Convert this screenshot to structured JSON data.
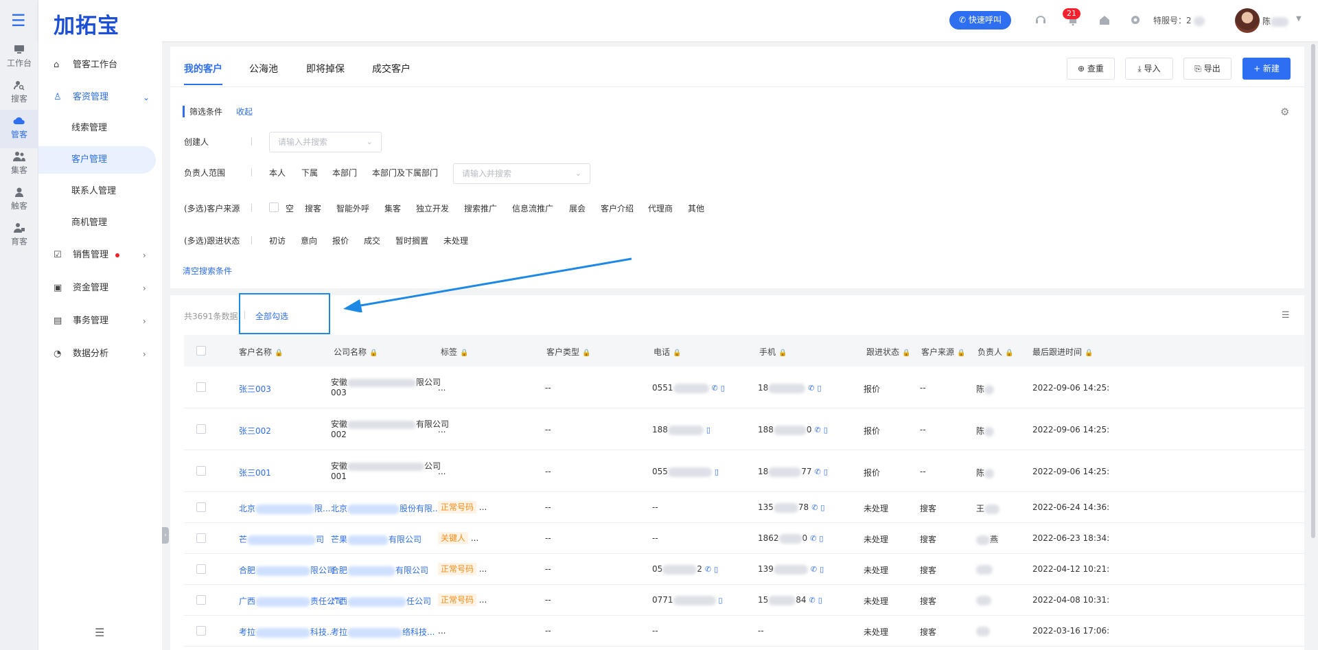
{
  "rail": [
    {
      "label": "工作台",
      "icon": "monitor-icon"
    },
    {
      "label": "搜客",
      "icon": "search-user-icon"
    },
    {
      "label": "管客",
      "icon": "crm-cloud-icon"
    },
    {
      "label": "集客",
      "icon": "group-icon"
    },
    {
      "label": "触客",
      "icon": "headset-user-icon"
    },
    {
      "label": "育客",
      "icon": "users-icon"
    }
  ],
  "topbar": {
    "logo": "加拓宝",
    "quick_call": "快速呼叫",
    "notification_count": "21",
    "account_label": "特服号：2",
    "user_name": "陈"
  },
  "sidenav": {
    "items": [
      {
        "label": "管客工作台"
      },
      {
        "label": "客资管理"
      },
      {
        "label": "线索管理"
      },
      {
        "label": "客户管理"
      },
      {
        "label": "联系人管理"
      },
      {
        "label": "商机管理"
      },
      {
        "label": "销售管理"
      },
      {
        "label": "资金管理"
      },
      {
        "label": "事务管理"
      },
      {
        "label": "数据分析"
      }
    ]
  },
  "tabs": [
    "我的客户",
    "公海池",
    "即将掉保",
    "成交客户"
  ],
  "actions": {
    "dedupe": "查重",
    "import": "导入",
    "export": "导出",
    "create": "+ 新建"
  },
  "filter": {
    "title": "筛选条件",
    "collapse": "收起",
    "creator_label": "创建人",
    "creator_placeholder": "请输入并搜索",
    "owner_label": "负责人范围",
    "owner_options": [
      "本人",
      "下属",
      "本部门",
      "本部门及下属部门"
    ],
    "owner_placeholder": "请输入并搜索",
    "source_label": "(多选)客户来源",
    "source_options": [
      "空",
      "搜客",
      "智能外呼",
      "集客",
      "独立开发",
      "搜索推广",
      "信息流推广",
      "展会",
      "客户介绍",
      "代理商",
      "其他"
    ],
    "status_label": "(多选)跟进状态",
    "status_options": [
      "初访",
      "意向",
      "报价",
      "成交",
      "暂时搁置",
      "未处理"
    ],
    "clear": "清空搜索条件"
  },
  "table": {
    "count_text": "共3691条数据",
    "select_all": "全部勾选",
    "columns": [
      "客户名称",
      "公司名称",
      "标签",
      "客户类型",
      "电话",
      "手机",
      "跟进状态",
      "客户来源",
      "负责人",
      "最后跟进时间"
    ],
    "rows": [
      {
        "name": "张三003",
        "company_a": "安徽",
        "company_b": "限公司",
        "company_line2": "003",
        "tag": "",
        "tag_more": "...",
        "type": "--",
        "phone": "0551",
        "mobile": "18",
        "status": "报价",
        "source": "--",
        "owner": "陈",
        "time": "2022-09-06 14:25:"
      },
      {
        "name": "张三002",
        "company_a": "安徽",
        "company_b": "有限公司",
        "company_line2": "002",
        "tag": "",
        "tag_more": "...",
        "type": "--",
        "phone": "188",
        "mobile": "188",
        "mobile_tail": "0",
        "status": "报价",
        "source": "--",
        "owner": "陈",
        "time": "2022-09-06 14:25:"
      },
      {
        "name": "张三001",
        "company_a": "安徽",
        "company_b": "公司",
        "company_line2": "001",
        "tag": "",
        "tag_more": "...",
        "type": "--",
        "phone": "055",
        "mobile": "18",
        "mobile_tail": "77",
        "status": "报价",
        "source": "--",
        "owner": "陈",
        "time": "2022-09-06 14:25:"
      },
      {
        "name": "北京",
        "name_tail": "限...",
        "company_a": "北京",
        "company_b": "股份有限...",
        "company_line2": "",
        "tag": "正常号码",
        "tag_more": "...",
        "type": "--",
        "phone": "--",
        "mobile": "135",
        "mobile_tail": "78",
        "status": "未处理",
        "source": "搜客",
        "owner": "王",
        "time": "2022-06-24 14:36:"
      },
      {
        "name": "芒",
        "name_tail": "司",
        "company_a": "芒果",
        "company_b": "有限公司",
        "company_line2": "",
        "tag": "关键人",
        "tag_more": "...",
        "type": "--",
        "phone": "--",
        "mobile": "1862",
        "mobile_tail": "0",
        "status": "未处理",
        "source": "搜客",
        "owner": "燕",
        "time": "2022-06-23 18:34:"
      },
      {
        "name": "合肥",
        "name_tail": "限公司",
        "company_a": "合肥",
        "company_b": "有限公司",
        "company_line2": "",
        "tag": "正常号码",
        "tag_more": "...",
        "type": "--",
        "phone": "05",
        "phone_tail": "2",
        "mobile": "139",
        "status": "未处理",
        "source": "搜客",
        "owner": "",
        "time": "2022-04-12 10:21:"
      },
      {
        "name": "广西",
        "name_tail": "责任公司",
        "company_a": "广西",
        "company_b": "任公司",
        "company_line2": "",
        "tag": "正常号码",
        "tag_more": "...",
        "type": "--",
        "phone": "0771",
        "mobile": "15",
        "mobile_tail": "84",
        "status": "未处理",
        "source": "搜客",
        "owner": "",
        "time": "2022-04-08 10:31:"
      },
      {
        "name": "考拉",
        "name_tail": "科技...",
        "company_a": "考拉",
        "company_b": "络科技...",
        "company_line2": "",
        "tag": "",
        "tag_more": "...",
        "type": "--",
        "phone": "--",
        "mobile": "--",
        "status": "未处理",
        "source": "搜客",
        "owner": "",
        "time": "2022-03-16 17:06:"
      }
    ]
  },
  "colors": {
    "primary": "#2e6ef0",
    "highlight_border": "#1e88e5",
    "tag_orange": "#fa8c16",
    "badge_red": "#f5222d"
  }
}
